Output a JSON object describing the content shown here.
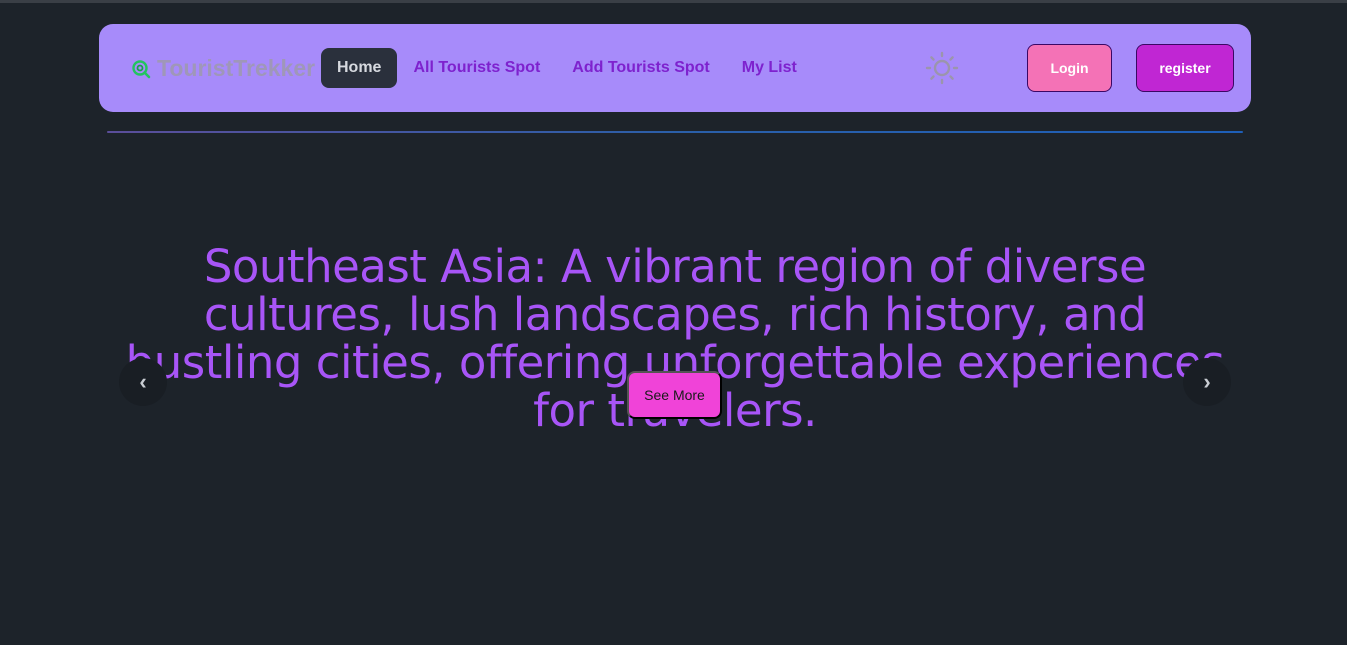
{
  "brand": {
    "name": "TouristTrekker",
    "icon": "globe-search-icon"
  },
  "nav": {
    "links": [
      {
        "label": "Home",
        "active": true
      },
      {
        "label": "All Tourists Spot",
        "active": false
      },
      {
        "label": "Add Tourists Spot",
        "active": false
      },
      {
        "label": "My List",
        "active": false
      }
    ],
    "theme_icon": "sun-icon"
  },
  "auth": {
    "login_label": "Login",
    "register_label": "register"
  },
  "hero": {
    "headline": "Southeast Asia: A vibrant region of diverse cultures, lush landscapes, rich history, and bustling cities, offering unforgettable experiences for travelers.",
    "cta_label": "See More",
    "prev_glyph": "‹",
    "next_glyph": "›"
  },
  "colors": {
    "page_bg": "#1d232a",
    "navbar_bg": "#a78bfa",
    "nav_link": "#7e22ce",
    "active_link_bg": "#2a303c",
    "login_bg": "#f472b6",
    "register_bg": "#c026d3",
    "headline": "#a855f7",
    "cta_bg": "#f043d8"
  }
}
